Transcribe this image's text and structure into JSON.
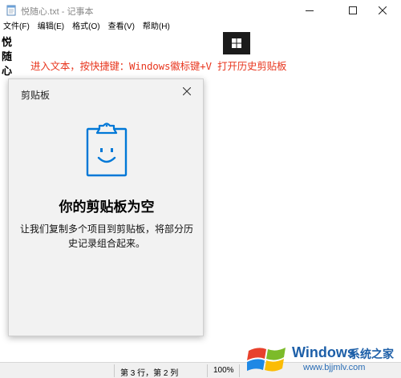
{
  "window": {
    "title": "悦随心.txt - 记事本",
    "app_icon": "notepad-icon",
    "controls": [
      "minimize-icon",
      "maximize-icon",
      "close-icon"
    ]
  },
  "menu": {
    "items": [
      "文件(F)",
      "编辑(E)",
      "格式(O)",
      "查看(V)",
      "帮助(H)"
    ]
  },
  "editor": {
    "lines": [
      "悦",
      "随",
      "心"
    ]
  },
  "annotation": {
    "text": "进入文本，按快捷键：Windows徽标键+V 打开历史剪贴板",
    "color": "#e8371f",
    "key_icon": "windows-key-icon"
  },
  "clipboard_panel": {
    "title": "剪贴板",
    "close_icon": "close-icon",
    "illustration": "clipboard-smiley-icon",
    "heading": "你的剪贴板为空",
    "description": "让我们复制多个项目到剪贴板，将部分历史记录组合起来。",
    "accent": "#0078d7"
  },
  "status_bar": {
    "position": "第 3 行，第 2 列",
    "zoom": "100%"
  },
  "watermark": {
    "brand": "Windows",
    "brand_cn": "系统之家",
    "url": "www.bjjmlv.com",
    "logo": "windows-logo-icon",
    "color": "#1d5fa8"
  }
}
